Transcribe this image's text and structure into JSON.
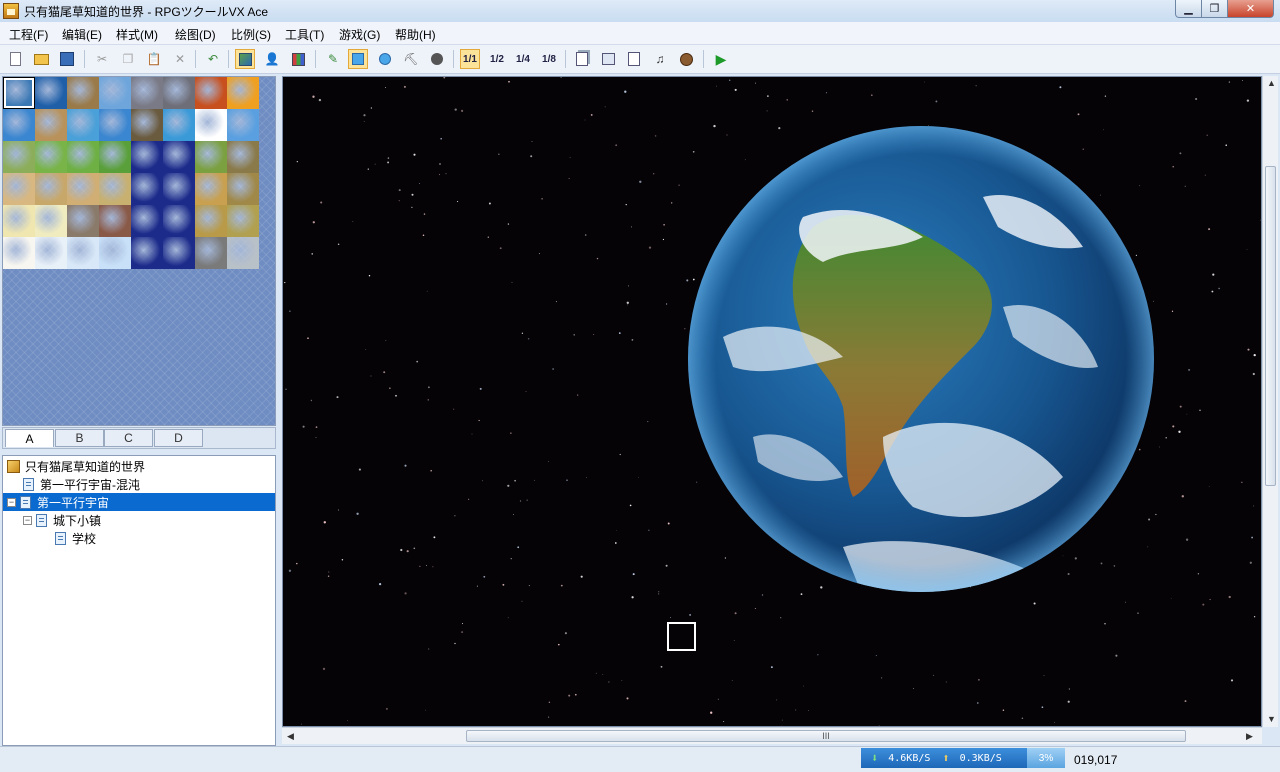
{
  "window": {
    "title": "只有猫尾草知道的世界 - RPGツクールVX Ace"
  },
  "menu": [
    "工程(F)",
    "编辑(E)",
    "样式(M)",
    "绘图(D)",
    "比例(S)",
    "工具(T)",
    "游戏(G)",
    "帮助(H)"
  ],
  "toolbar": {
    "icons": [
      "new-project-icon",
      "open-project-icon",
      "save-project-icon",
      "cut-icon",
      "copy-icon",
      "paste-icon",
      "delete-icon",
      "undo-icon",
      "map-layer-icon",
      "event-layer-icon",
      "region-layer-icon",
      "pencil-icon",
      "rectangle-icon",
      "ellipse-icon",
      "fill-icon",
      "shadow-pen-icon",
      "zoom-1-1-icon",
      "zoom-1-2-icon",
      "zoom-1-4-icon",
      "zoom-1-8-icon",
      "database-icon",
      "resource-manager-icon",
      "script-editor-icon",
      "sound-test-icon",
      "character-generator-icon",
      "playtest-icon"
    ],
    "zoom_labels": [
      "1/1",
      "1/2",
      "1/4",
      "1/8"
    ]
  },
  "tileset": {
    "tabs": [
      "A",
      "B",
      "C",
      "D"
    ],
    "active_tab": "A",
    "tile_colors": [
      [
        "#3a78b4",
        "#1f5fa8",
        "#9a7a48",
        "#6ea6dc",
        "#7a7a86",
        "#6e6e78",
        "#c8501e",
        "#f0a020"
      ],
      [
        "#3a86d0",
        "#b8925a",
        "#4aa0d8",
        "#3a86d0",
        "#6a5a3e",
        "#3a9ad8",
        "#ffffff",
        "#5aa0e0"
      ],
      [
        "#8cae5a",
        "#78b448",
        "#6eb044",
        "#5aa03a",
        "#1c2a8a",
        "#1c2a8a",
        "#7aa040",
        "#8a7a4a"
      ],
      [
        "#d8b880",
        "#c8a86a",
        "#d0ae74",
        "#c8b070",
        "#1c2a8a",
        "#1c2a8a",
        "#c8a050",
        "#a08848"
      ],
      [
        "#f0e6b0",
        "#f0ecc0",
        "#8a7a6a",
        "#8a5a48",
        "#1c2a8a",
        "#1c2a8a",
        "#b89a48",
        "#b0a050"
      ],
      [
        "#f8f6f0",
        "#e8f0f8",
        "#d8e8f8",
        "#c8e0f8",
        "#1c2a8a",
        "#1c2a8a",
        "#7a7a7a",
        "#b8c0c8"
      ]
    ]
  },
  "map_tree": [
    {
      "label": "只有猫尾草知道的世界",
      "type": "project",
      "indent": 0,
      "toggle": "",
      "selected": false
    },
    {
      "label": "第一平行宇宙-混沌",
      "type": "map",
      "indent": 1,
      "toggle": "",
      "selected": false
    },
    {
      "label": "第一平行宇宙",
      "type": "map",
      "indent": 0,
      "toggle": "−",
      "selected": true
    },
    {
      "label": "城下小镇",
      "type": "map",
      "indent": 1,
      "toggle": "−",
      "selected": false
    },
    {
      "label": "学校",
      "type": "map",
      "indent": 2,
      "toggle": "",
      "selected": false
    }
  ],
  "mapview": {
    "background": "#050306",
    "planet": "earth"
  },
  "scrollbar": {
    "grip": "III"
  },
  "status": {
    "download": "4.6KB/S",
    "upload": "0.3KB/S",
    "percent": "3%",
    "coords": "019,017"
  }
}
